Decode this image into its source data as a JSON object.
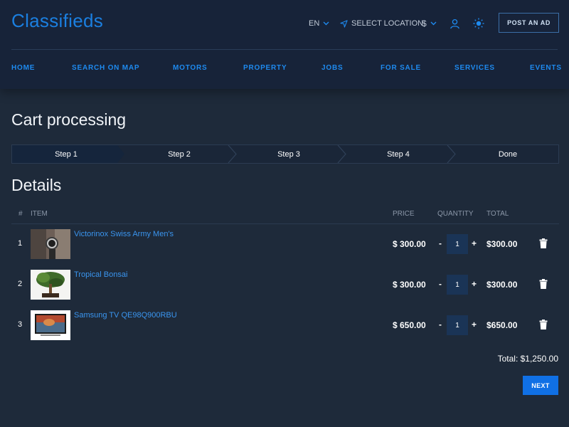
{
  "header": {
    "logo": "Classifieds",
    "language": "EN",
    "location": "SELECT LOCATION",
    "currency": "$",
    "post_ad": "POST AN AD"
  },
  "nav": [
    "HOME",
    "SEARCH ON MAP",
    "MOTORS",
    "PROPERTY",
    "JOBS",
    "FOR SALE",
    "SERVICES",
    "EVENTS"
  ],
  "page_title": "Cart processing",
  "steps": [
    "Step 1",
    "Step 2",
    "Step 3",
    "Step 4",
    "Done"
  ],
  "active_step": "Step 1",
  "details_title": "Details",
  "table": {
    "headers": [
      "#",
      "ITEM",
      "PRICE",
      "QUANTITY",
      "TOTAL"
    ],
    "rows": [
      {
        "num": "1",
        "name": "Victorinox Swiss Army Men's",
        "price": "$ 300.00",
        "qty": "1",
        "total": "$300.00"
      },
      {
        "num": "2",
        "name": "Tropical Bonsai",
        "price": "$ 300.00",
        "qty": "1",
        "total": "$300.00"
      },
      {
        "num": "3",
        "name": "Samsung TV QE98Q900RBU",
        "price": "$ 650.00",
        "qty": "1",
        "total": "$650.00"
      }
    ],
    "minus": "-",
    "plus": "+"
  },
  "cart_total": "Total: $1,250.00",
  "next_label": "NEXT",
  "colors": {
    "background": "#1e2a3a",
    "header": "#172339",
    "accent": "#1e8aef",
    "button": "#1070e5"
  }
}
